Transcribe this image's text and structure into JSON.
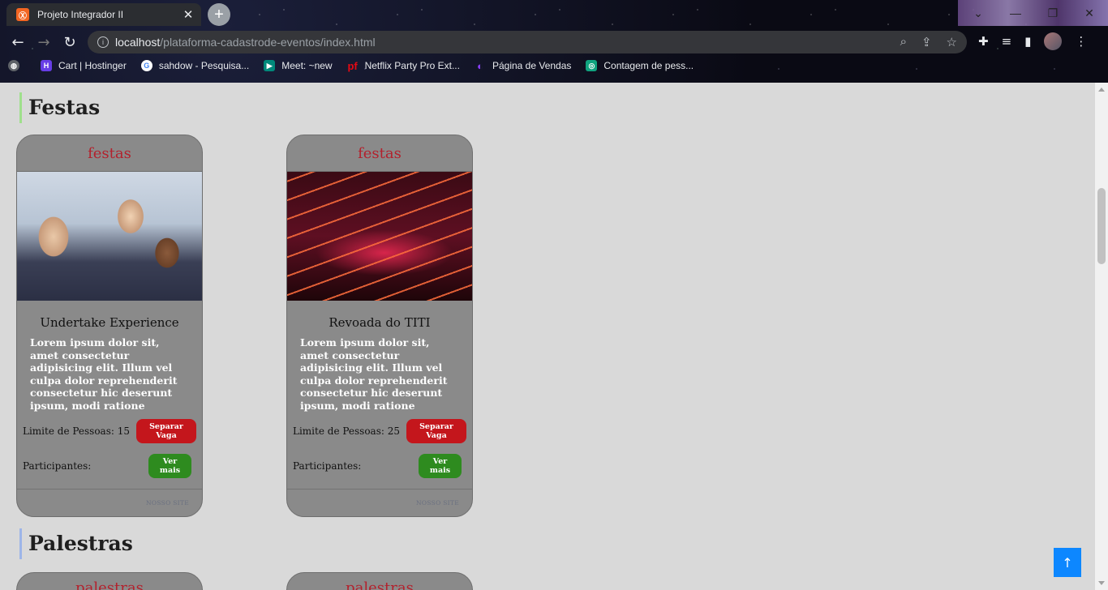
{
  "browser": {
    "tab_title": "Projeto Integrador II",
    "tab_favicon_text": "Ⓧ",
    "url_host": "localhost",
    "url_path": "/plataforma-cadastrode-eventos/index.html",
    "bookmarks": [
      {
        "label": "Cart | Hostinger",
        "icon": "hostinger-icon",
        "color": "#673de6",
        "glyph": "H"
      },
      {
        "label": "sahdow - Pesquisa...",
        "icon": "google-icon",
        "color": "#4285f4",
        "glyph": "G"
      },
      {
        "label": "Meet: ~new",
        "icon": "meet-icon",
        "color": "#00897b",
        "glyph": "▶"
      },
      {
        "label": "Netflix Party Pro Ext...",
        "icon": "pf-icon",
        "color": "#e50914",
        "glyph": "pf"
      },
      {
        "label": "Página de Vendas",
        "icon": "circle-icon",
        "color": "#6f2dbd",
        "glyph": "◐"
      },
      {
        "label": "Contagem de pess...",
        "icon": "openai-icon",
        "color": "#10a37f",
        "glyph": "◎"
      }
    ]
  },
  "sections": {
    "festas_title": "Festas",
    "palestras_title": "Palestras"
  },
  "cards": [
    {
      "category": "festas",
      "name": "Undertake Experience",
      "description": "Lorem ipsum dolor sit, amet consectetur adipisicing elit. Illum vel culpa dolor reprehenderit consectetur hic deserunt ipsum, modi ratione voluptate cum neque impedit! Quis ab inventore perferendis.",
      "limit_label": "Limite de Pessoas: 15",
      "reserve_label": "Separar Vaga",
      "participants_label": "Participantes:",
      "more_label": "Ver mais",
      "footer": "NOSSO SITE"
    },
    {
      "category": "festas",
      "name": "Revoada do TITI",
      "description": "Lorem ipsum dolor sit, amet consectetur adipisicing elit. Illum vel culpa dolor reprehenderit consectetur hic deserunt ipsum, modi ratione voluptate cum neque impedit! Quis ab inventore perferendis.",
      "limit_label": "Limite de Pessoas: 25",
      "reserve_label": "Separar Vaga",
      "participants_label": "Participantes:",
      "more_label": "Ver mais",
      "footer": "NOSSO SITE"
    }
  ],
  "palestras_peek": [
    "palestras",
    "palestras"
  ],
  "colors": {
    "category_text": "#b3212d",
    "reserve_button": "#c4161c",
    "more_button": "#2e8b1f",
    "back_to_top": "#0d87ff"
  },
  "icons": {
    "back_to_top": "↑"
  }
}
